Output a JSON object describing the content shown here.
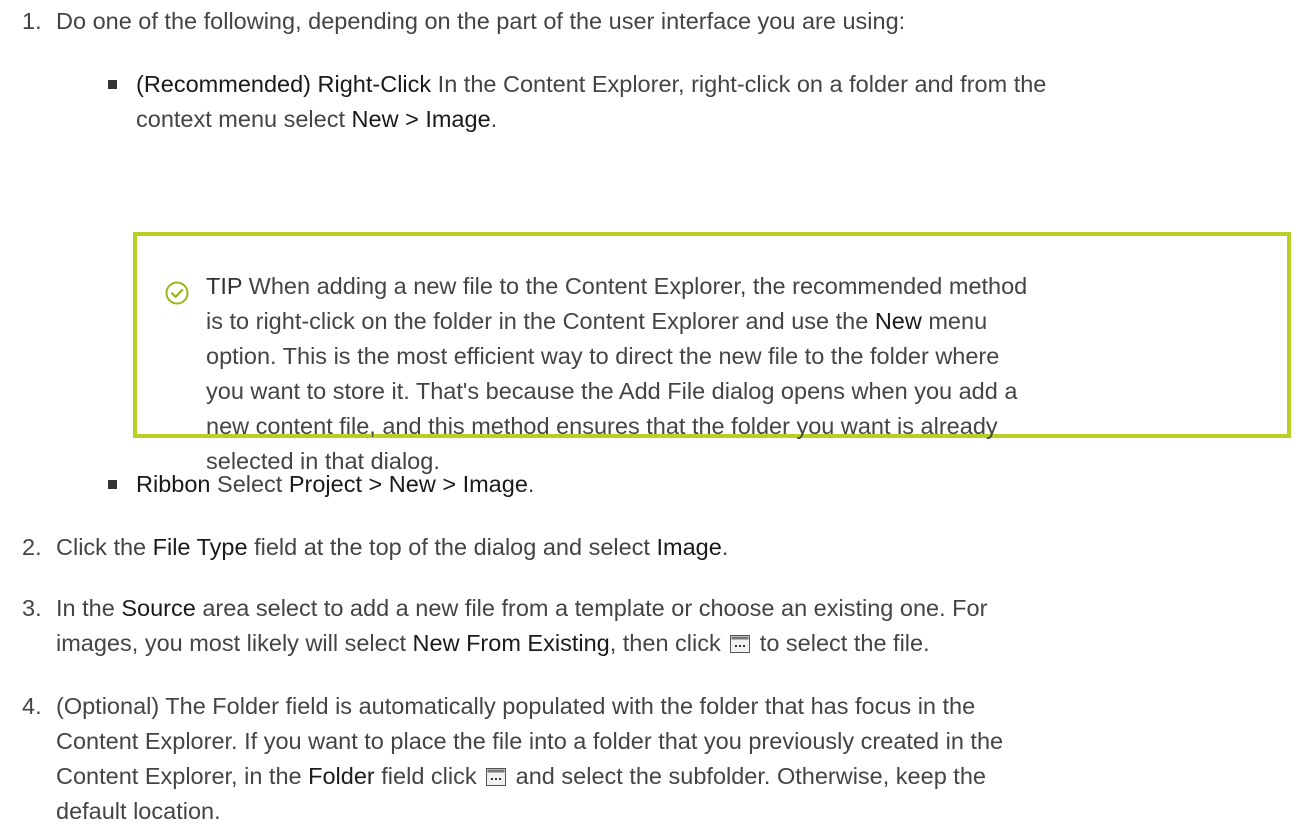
{
  "step1": {
    "number": "1.",
    "text": "Do one of the following, depending on the part of the user interface you are using:",
    "option_a": {
      "label": "(Recommended) Right-Click",
      "text_1": " In the Content Explorer, right-click on a folder and from the",
      "text_2": "context menu select ",
      "menu_path": "New > Image",
      "end": "."
    },
    "tip": {
      "icon": "check-circle-icon",
      "label": "TIP",
      "line1": " When adding a new file to the Content Explorer, the recommended method",
      "line2": "is to right-click on the folder in the Content Explorer and use the ",
      "new_label": "New",
      "line2_end": " menu",
      "line3": "option. This is the most efficient way to direct the new file to the folder where",
      "line4": "you want to store it. That's because the Add File dialog opens when you add a",
      "line5": "new content file, and this method ensures that the folder you want is already",
      "line6": "selected in that dialog.",
      "border_color": "#b9cf25"
    },
    "option_b": {
      "label": "Ribbon",
      "text": " Select ",
      "menu_path": "Project > New > Image",
      "end": "."
    }
  },
  "step2": {
    "number": "2.",
    "pre": "Click the ",
    "field": "File Type",
    "mid": " field at the top of the dialog and select ",
    "value": "Image",
    "end": "."
  },
  "step3": {
    "number": "3.",
    "pre": "In the ",
    "area": "Source",
    "line1_rest": " area select to add a new file from a template or choose an existing one. For",
    "line2_pre": "images, you most likely will select ",
    "option": "New From Existing",
    "line2_mid": ", then click ",
    "button_icon": "ellipsis-button-icon",
    "line2_end": " to select the file."
  },
  "step4": {
    "number": "4.",
    "line1": "(Optional) The Folder field is automatically populated with the folder that has focus in the",
    "line2": "Content Explorer. If you want to place the file into a folder that you previously created in the",
    "line3_pre": "Content Explorer, in the ",
    "field": "Folder",
    "line3_mid": " field click ",
    "button_icon": "ellipsis-button-icon",
    "line3_end": " and select the subfolder. Otherwise, keep the",
    "line4": "default location."
  }
}
